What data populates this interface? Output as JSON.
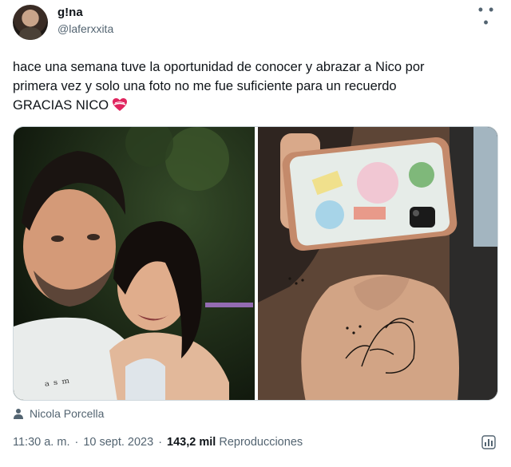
{
  "author": {
    "display_name": "g!na",
    "handle": "@laferxxita"
  },
  "tweet": {
    "text_line1": "hace una semana tuve la oportunidad de conocer y abrazar a Nico por",
    "text_line2": "primera vez y solo una foto no me fue suficiente para un recuerdo",
    "text_line3": "GRACIAS NICO",
    "heart_emoji": "heart-with-ribbon-icon"
  },
  "tagged": {
    "person": "Nicola Porcella"
  },
  "meta": {
    "time": "11:30 a. m.",
    "separator1": "·",
    "date": "10 sept. 2023",
    "separator2": "·",
    "views": "143,2 mil",
    "views_label": "Reproducciones"
  },
  "colors": {
    "text": "#0f1419",
    "secondary": "#536471",
    "border": "#cfd9de"
  }
}
